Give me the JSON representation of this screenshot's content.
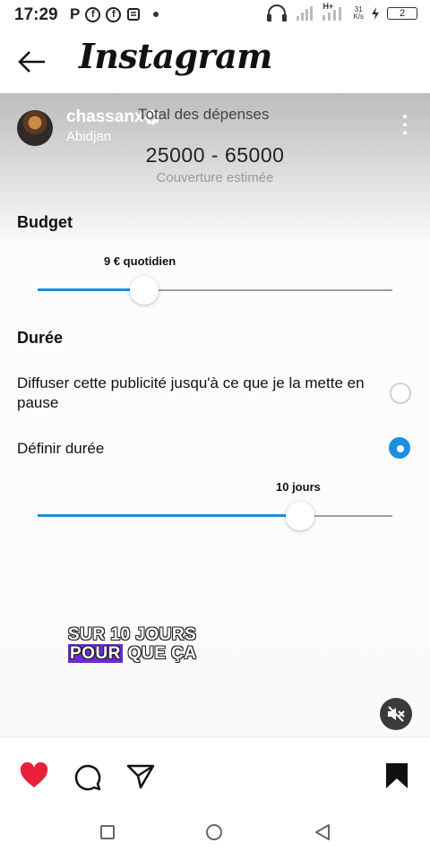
{
  "status_bar": {
    "time": "17:29",
    "left_icons": [
      "P",
      "f",
      "f",
      "news-icon"
    ],
    "network_badge": "H+",
    "net_speed_value": "31",
    "net_speed_unit": "K/s",
    "battery": "2"
  },
  "header": {
    "app_title": "Instagram"
  },
  "post": {
    "username": "chassanx",
    "location": "Abidjan",
    "spend": {
      "title": "Total des dépenses",
      "amount": "25000 - 65000",
      "subtitle": "Couverture estimée"
    },
    "budget": {
      "title": "Budget",
      "label": "9 € quotidien",
      "fraction": 0.3
    },
    "duration": {
      "title": "Durée",
      "option_pause": "Diffuser cette publicité jusqu'à ce que je la mette en pause",
      "option_define": "Définir durée",
      "selected": "define",
      "label": "10 jours",
      "fraction": 0.74
    },
    "caption": {
      "line1": "SUR 10 JOURS",
      "line2_highlight": "POUR",
      "line2_rest": "QUE ÇA"
    }
  },
  "colors": {
    "accent": "#1d8fe0",
    "like": "#e8203a",
    "caption_highlight": "#6b2bd6"
  },
  "icons": {
    "back": "arrow-left-icon",
    "verified": "verified-badge-icon",
    "more": "more-vertical-icon",
    "mute": "speaker-muted-icon",
    "like": "heart-filled-icon",
    "comment": "comment-bubble-icon",
    "share": "paper-plane-icon",
    "save": "bookmark-filled-icon",
    "nav_recents": "square-icon",
    "nav_home": "circle-icon",
    "nav_back": "triangle-back-icon"
  }
}
